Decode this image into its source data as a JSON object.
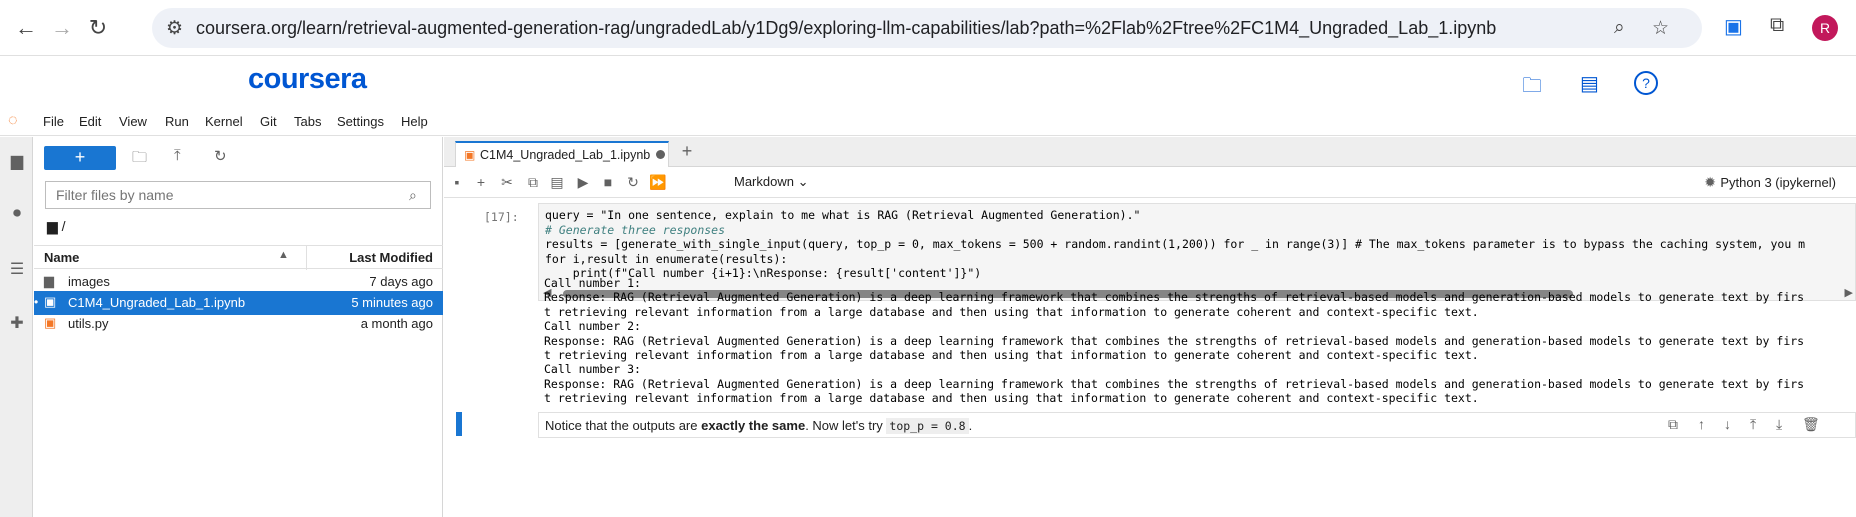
{
  "browser": {
    "url": "coursera.org/learn/retrieval-augmented-generation-rag/ungradedLab/y1Dg9/exploring-llm-capabilities/lab?path=%2Flab%2Ftree%2FC1M4_Ungraded_Lab_1.ipynb",
    "avatar_letter": "R"
  },
  "coursera": {
    "logo": "coursera"
  },
  "menu": [
    "File",
    "Edit",
    "View",
    "Run",
    "Kernel",
    "Git",
    "Tabs",
    "Settings",
    "Help"
  ],
  "filebrowser": {
    "new_label": "+",
    "filter_placeholder": "Filter files by name",
    "breadcrumb": "/",
    "col_name": "Name",
    "col_modified": "Last Modified",
    "files": [
      {
        "name": "images",
        "modified": "7 days ago",
        "icon": "folder-icon"
      },
      {
        "name": "C1M4_Ungraded_Lab_1.ipynb",
        "modified": "5 minutes ago",
        "icon": "notebook-icon"
      },
      {
        "name": "utils.py",
        "modified": "a month ago",
        "icon": "python-file-icon"
      }
    ]
  },
  "notebook": {
    "tab_label": "C1M4_Ungraded_Lab_1.ipynb",
    "cell_type": "Markdown",
    "kernel": "Python 3 (ipykernel)",
    "prompt": "[17]:",
    "code_lines": [
      "query = \"In one sentence, explain to me what is RAG (Retrieval Augmented Generation).\"",
      "# Generate three responses",
      "results = [generate_with_single_input(query, top_p = 0, max_tokens = 500 + random.randint(1,200)) for _ in range(3)] # The max_tokens parameter is to bypass the caching system, you m",
      "for i,result in enumerate(results):",
      "    print(f\"Call number {i+1}:\\nResponse: {result['content']}\")"
    ],
    "output_lines": [
      "Call number 1:",
      "Response: RAG (Retrieval Augmented Generation) is a deep learning framework that combines the strengths of retrieval-based models and generation-based models to generate text by firs",
      "t retrieving relevant information from a large database and then using that information to generate coherent and context-specific text.",
      "Call number 2:",
      "Response: RAG (Retrieval Augmented Generation) is a deep learning framework that combines the strengths of retrieval-based models and generation-based models to generate text by firs",
      "t retrieving relevant information from a large database and then using that information to generate coherent and context-specific text.",
      "Call number 3:",
      "Response: RAG (Retrieval Augmented Generation) is a deep learning framework that combines the strengths of retrieval-based models and generation-based models to generate text by firs",
      "t retrieving relevant information from a large database and then using that information to generate coherent and context-specific text."
    ],
    "markdown": {
      "before": "Notice that the outputs are ",
      "bold": "exactly the same",
      "middle": ". Now let's try ",
      "code": "top_p = 0.8",
      "after": "."
    }
  },
  "colors": {
    "accent": "#1976d2",
    "coursera_blue": "#0056d2",
    "jupyter_orange": "#f37726"
  }
}
